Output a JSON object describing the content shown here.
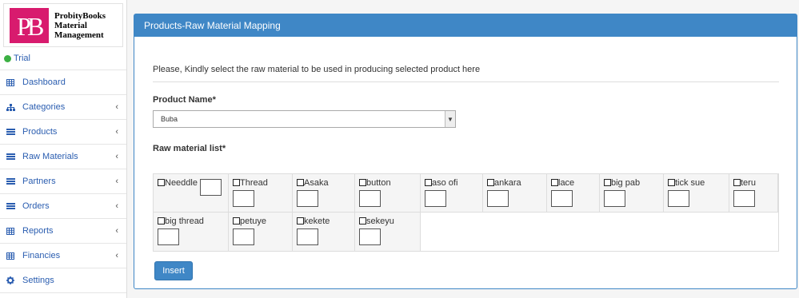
{
  "brand": {
    "line1": "ProbityBooks",
    "line2": "Material",
    "line3": "Management",
    "logo_color": "#d81b6e"
  },
  "sidebar": {
    "trial_label": "Trial",
    "items": [
      {
        "label": "Dashboard",
        "icon": "table-icon",
        "has_children": false
      },
      {
        "label": "Categories",
        "icon": "sitemap-icon",
        "has_children": true
      },
      {
        "label": "Products",
        "icon": "list-icon",
        "has_children": true
      },
      {
        "label": "Raw Materials",
        "icon": "list-icon",
        "has_children": true
      },
      {
        "label": "Partners",
        "icon": "list-icon",
        "has_children": true
      },
      {
        "label": "Orders",
        "icon": "list-icon",
        "has_children": true
      },
      {
        "label": "Reports",
        "icon": "table-icon",
        "has_children": true
      },
      {
        "label": "Financies",
        "icon": "table-icon",
        "has_children": true
      },
      {
        "label": "Settings",
        "icon": "gear-icon",
        "has_children": false
      }
    ],
    "chevron": "‹"
  },
  "panel": {
    "title": "Products-Raw Material Mapping",
    "intro": "Please, Kindly select the raw material to be used in producing selected product here",
    "product_label": "Product Name*",
    "product_selected": "Buba",
    "raw_label": "Raw material list*",
    "insert_label": "Insert",
    "accent": "#3f87c6"
  },
  "raw_materials": {
    "row1": [
      {
        "name": "Needdle",
        "inline": true
      },
      {
        "name": "Thread"
      },
      {
        "name": "Asaka"
      },
      {
        "name": "button"
      },
      {
        "name": "aso ofi"
      },
      {
        "name": "ankara"
      },
      {
        "name": "lace"
      },
      {
        "name": "big pab"
      },
      {
        "name": "tick sue"
      },
      {
        "name": "teru"
      }
    ],
    "row2": [
      {
        "name": "big thread"
      },
      {
        "name": "petuye"
      },
      {
        "name": "kekete"
      },
      {
        "name": "sekeyu"
      }
    ]
  }
}
